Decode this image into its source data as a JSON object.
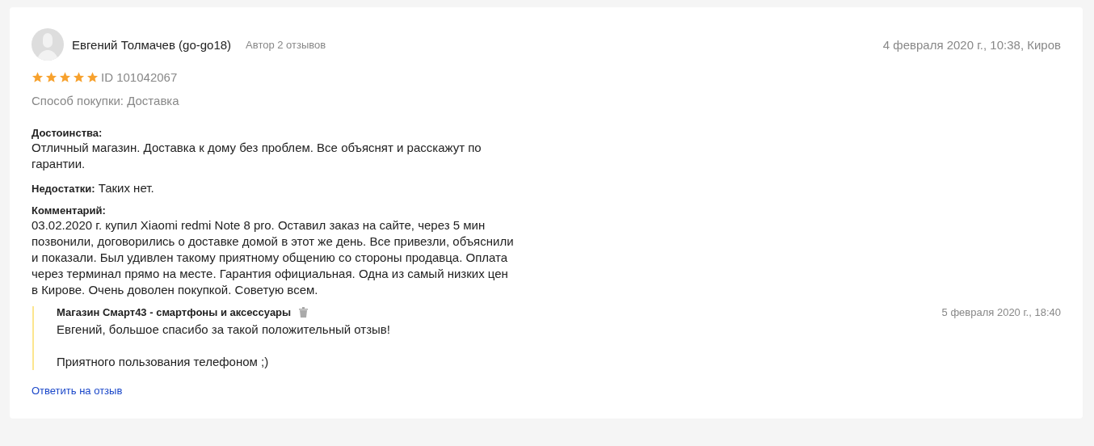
{
  "review": {
    "author": "Евгений Толмачев (go-go18)",
    "author_reviews": "Автор 2 отзывов",
    "date": "4 февраля 2020 г., 10:38, Киров",
    "stars": 5,
    "id": "ID 101042067",
    "purchase": "Способ покупки: Доставка",
    "sections": [
      {
        "kind": "block",
        "label": "Достоинства:",
        "text": "Отличный магазин. Доставка к дому без проблем. Все объяснят и расскажут по гарантии."
      },
      {
        "kind": "inline",
        "label": "Недостатки:",
        "text": "Таких нет."
      },
      {
        "kind": "block",
        "label": "Комментарий:",
        "text": "03.02.2020 г. купил Xiaomi redmi Note 8 pro. Оставил заказ на сайте, через 5 мин позвонили, договорились о доставке домой в этот же день. Все привезли, объяснили и показали. Был удивлен такому приятному общению со стороны продавца. Оплата через терминал прямо на месте. Гарантия официальная. Одна из самый низких цен в Кирове. Очень доволен покупкой. Советую всем."
      }
    ],
    "reply": {
      "author": "Магазин Смарт43 - смартфоны и аксессуары",
      "date": "5 февраля 2020 г., 18:40",
      "paragraphs": [
        "Евгений, большое спасибо за такой положительный отзыв!",
        "Приятного пользования телефоном ;)"
      ]
    },
    "reply_link": "Ответить на отзыв"
  }
}
